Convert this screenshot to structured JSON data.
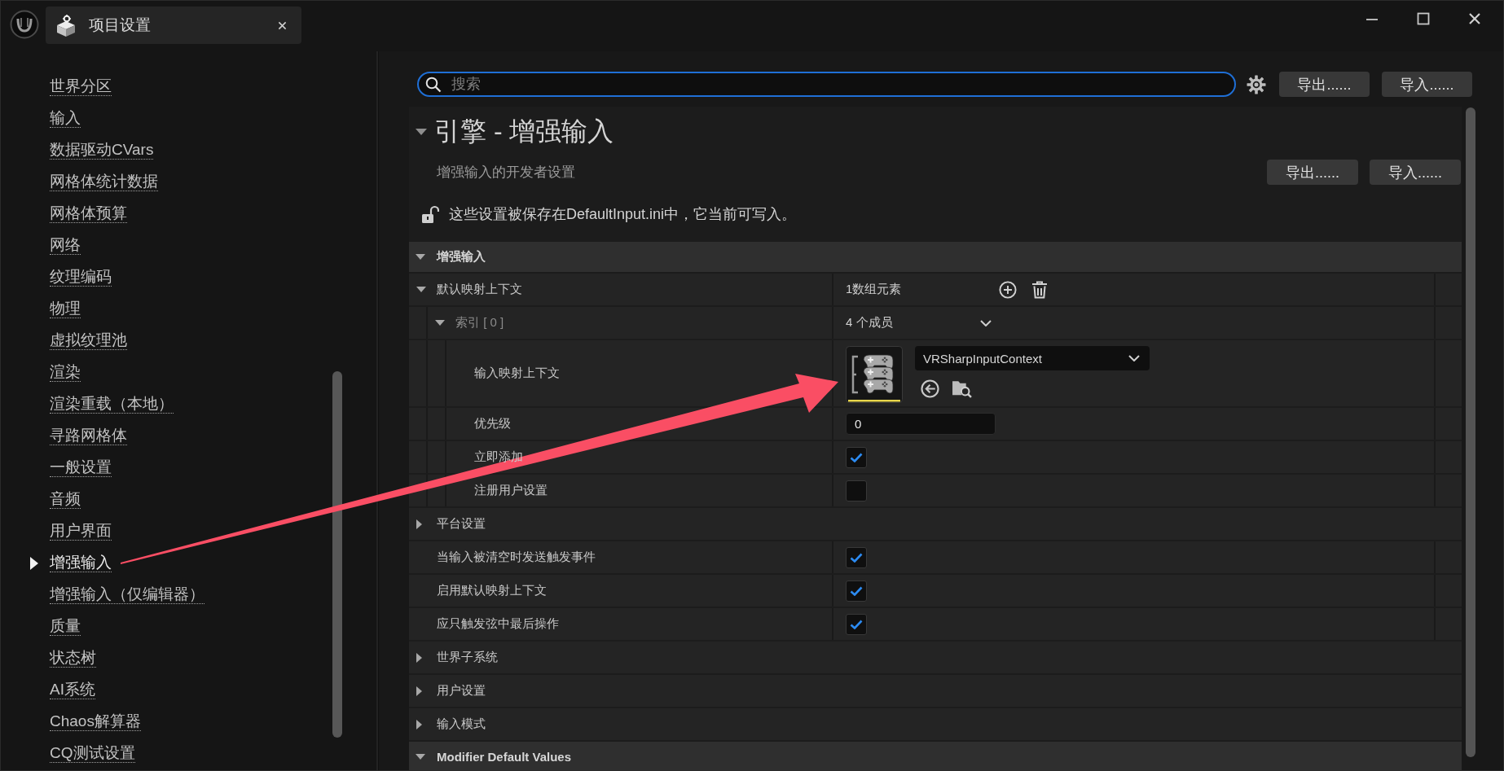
{
  "tabs": [
    {
      "label": "项目设置",
      "selected": true
    }
  ],
  "sidebar": {
    "items": [
      {
        "label": "世界分区",
        "selected": false
      },
      {
        "label": "输入",
        "selected": false
      },
      {
        "label": "数据驱动CVars",
        "selected": false
      },
      {
        "label": "网格体统计数据",
        "selected": false
      },
      {
        "label": "网格体预算",
        "selected": false
      },
      {
        "label": "网络",
        "selected": false
      },
      {
        "label": "纹理编码",
        "selected": false
      },
      {
        "label": "物理",
        "selected": false
      },
      {
        "label": "虚拟纹理池",
        "selected": false
      },
      {
        "label": "渲染",
        "selected": false
      },
      {
        "label": "渲染重载（本地）",
        "selected": false
      },
      {
        "label": "寻路网格体",
        "selected": false
      },
      {
        "label": "一般设置",
        "selected": false
      },
      {
        "label": "音频",
        "selected": false
      },
      {
        "label": "用户界面",
        "selected": false
      },
      {
        "label": "增强输入",
        "selected": true
      },
      {
        "label": "增强输入（仅编辑器）",
        "selected": false
      },
      {
        "label": "质量",
        "selected": false
      },
      {
        "label": "状态树",
        "selected": false
      },
      {
        "label": "AI系统",
        "selected": false
      },
      {
        "label": "Chaos解算器",
        "selected": false
      },
      {
        "label": "CQ测试设置",
        "selected": false
      }
    ]
  },
  "toolbar": {
    "search": {
      "placeholder": "搜索"
    },
    "buttons": [
      "导出......",
      "导入......"
    ]
  },
  "section": {
    "title": "引擎 - 增强输入",
    "expanded": true,
    "description": "增强输入的开发者设置",
    "buttons": [
      "导出......",
      "导入......"
    ],
    "locked": false,
    "notice": "这些设置被保存在DefaultInput.ini中，它当前可写入。"
  },
  "categories": [
    {
      "title": "增强输入",
      "expanded": true,
      "rows": [
        {
          "kind": "array",
          "label": "默认映射上下文",
          "expanded": true,
          "value": "1数组元素",
          "children": [
            {
              "kind": "struct",
              "label": "索引 [ 0 ]",
              "expanded": true,
              "value": "4 个成员",
              "children": [
                {
                  "kind": "asset",
                  "label": "输入映射上下文",
                  "value": "VRSharpInputContext"
                },
                {
                  "kind": "number",
                  "label": "优先级",
                  "value": "0"
                },
                {
                  "kind": "checkbox",
                  "label": "立即添加",
                  "checked": true
                },
                {
                  "kind": "checkbox",
                  "label": "注册用户设置",
                  "checked": false
                }
              ]
            }
          ]
        },
        {
          "kind": "group",
          "label": "平台设置",
          "expanded": false
        },
        {
          "kind": "checkbox",
          "label": "当输入被清空时发送触发事件",
          "checked": true
        },
        {
          "kind": "checkbox",
          "label": "启用默认映射上下文",
          "checked": true
        },
        {
          "kind": "checkbox",
          "label": "应只触发弦中最后操作",
          "checked": true
        },
        {
          "kind": "group",
          "label": "世界子系统",
          "expanded": false
        },
        {
          "kind": "group",
          "label": "用户设置",
          "expanded": false
        },
        {
          "kind": "group",
          "label": "输入模式",
          "expanded": false
        }
      ]
    },
    {
      "title": "Modifier Default Values",
      "expanded": true
    }
  ]
}
